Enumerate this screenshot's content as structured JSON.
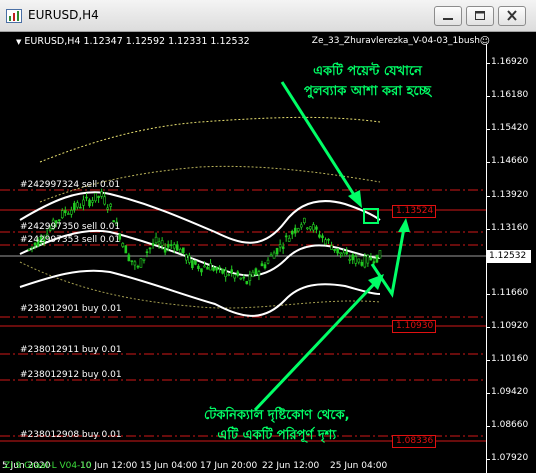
{
  "window": {
    "title": "EURUSD,H4"
  },
  "chart": {
    "symbol_line": "EURUSD,H4  1.12347 1.12592 1.12331 1.12532",
    "ea_name": "Ze_33_Zhuravlerezka_V-04-03_1bush",
    "current_price": "1.12532",
    "indicator_label": "Zi 9 Graal-L V04-10"
  },
  "price_axis": {
    "ticks": [
      "1.16920",
      "1.16180",
      "1.15420",
      "1.14660",
      "1.13920",
      "1.13160",
      "1.11660",
      "1.10920",
      "1.10160",
      "1.09420",
      "1.08660",
      "1.07920"
    ]
  },
  "time_axis": {
    "ticks": [
      "5 Jun 2020",
      "10 Jun 12:00",
      "15 Jun 04:00",
      "17 Jun 20:00",
      "22 Jun 12:00",
      "25 Jun 04:00"
    ]
  },
  "orders": [
    {
      "label": "#242997324 sell 0.01"
    },
    {
      "label": "#242997350 sell 0.01"
    },
    {
      "label": "#242997353 sell 0.01"
    },
    {
      "label": "#238012901 buy 0.01"
    },
    {
      "label": "#238012911 buy 0.01"
    },
    {
      "label": "#238012912 buy 0.01"
    },
    {
      "label": "#238012908 buy 0.01"
    }
  ],
  "price_boxes": [
    "1.13524",
    "1.10930",
    "1.08336"
  ],
  "annotations": {
    "top_line1": "একটি পয়েন্ট যেখানে",
    "top_line2": "পুলব্যাক আশা করা হচ্ছে",
    "bottom_line1": "টেকনিক্যাল দৃষ্টিকোণ থেকে,",
    "bottom_line2": "এটি একটি পরিপূর্ণ দৃশ্য"
  },
  "colors": {
    "background": "#000000",
    "candles": "#22cc22",
    "bands": "#ffffff",
    "outer_band": "#e8e070",
    "order_lines": "#d01818",
    "annotation": "#00ff66"
  },
  "chart_data": {
    "type": "candlestick",
    "title": "EURUSD,H4",
    "ylim": [
      1.0755,
      1.1735
    ],
    "close_path": [
      1.1265,
      1.1284,
      1.1302,
      1.133,
      1.1352,
      1.136,
      1.1372,
      1.138,
      1.1388,
      1.136,
      1.13,
      1.125,
      1.1222,
      1.1262,
      1.1282,
      1.127,
      1.128,
      1.1258,
      1.1232,
      1.1226,
      1.1228,
      1.1214,
      1.1212,
      1.1203,
      1.119,
      1.1212,
      1.1232,
      1.1258,
      1.128,
      1.1304,
      1.1328,
      1.1322,
      1.13,
      1.1282,
      1.1262,
      1.1248,
      1.1242,
      1.1238,
      1.1247,
      1.1253
    ]
  }
}
